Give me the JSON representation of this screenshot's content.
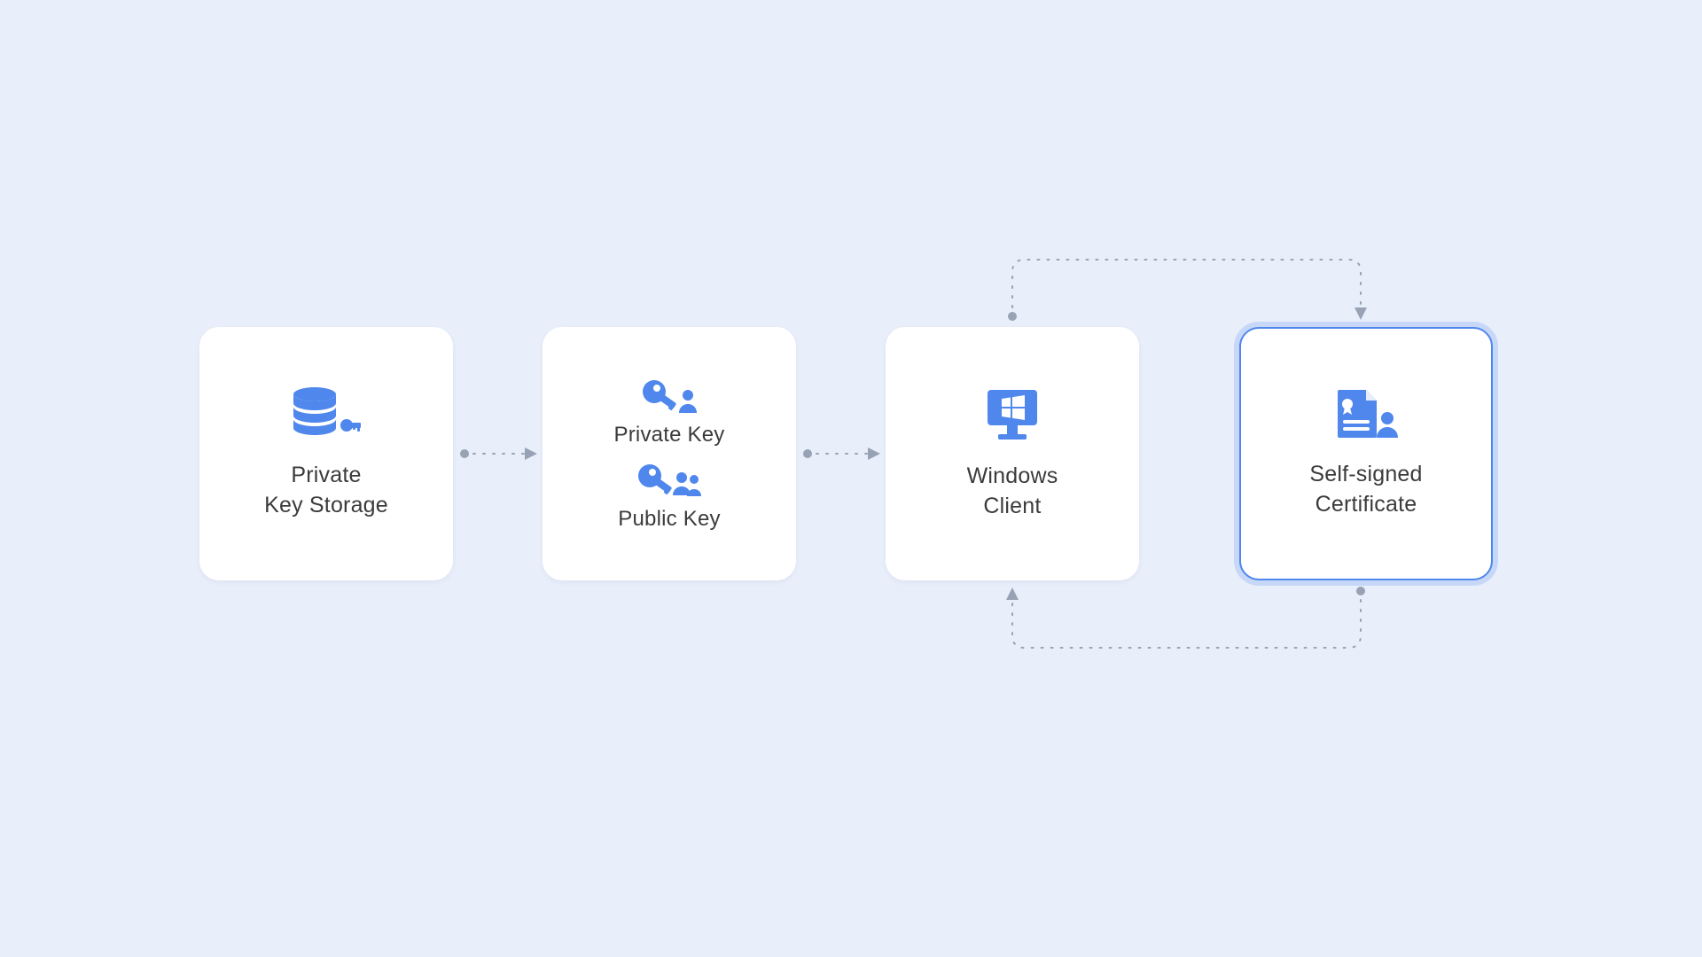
{
  "nodes": {
    "storage": {
      "label_l1": "Private",
      "label_l2": "Key Storage"
    },
    "keys": {
      "private_label": "Private Key",
      "public_label": "Public Key"
    },
    "client": {
      "label_l1": "Windows",
      "label_l2": "Client"
    },
    "cert": {
      "label_l1": "Self-signed",
      "label_l2": "Certificate"
    }
  },
  "colors": {
    "accent": "#4f87ed",
    "bg": "#e9eefb",
    "card": "#ffffff",
    "text": "#3b3b3b",
    "connector": "#97a3b4"
  }
}
